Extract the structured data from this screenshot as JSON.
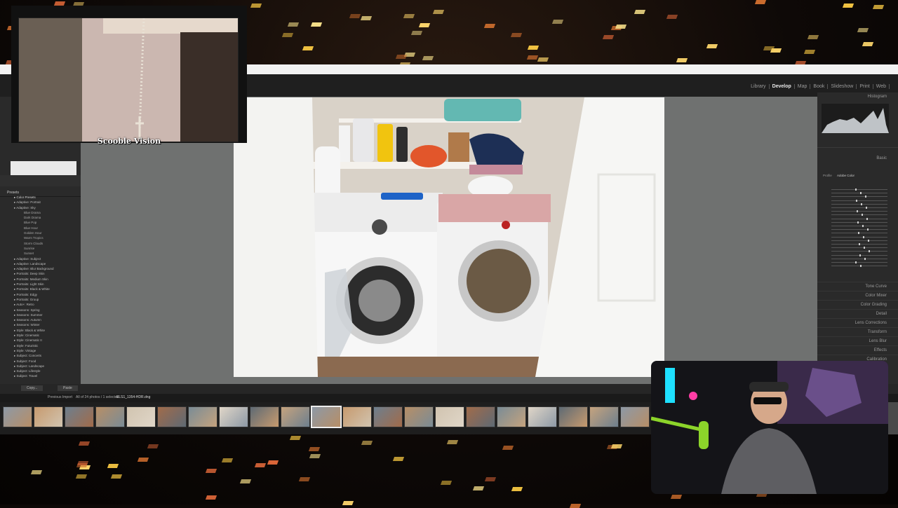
{
  "lightroom": {
    "modules": [
      "Library",
      "Develop",
      "Map",
      "Book",
      "Slideshow",
      "Print",
      "Web"
    ],
    "active_module": "Develop",
    "left_panel": {
      "section_title": "Presets",
      "presets": [
        {
          "label": "Color Presets",
          "kind": "head"
        },
        {
          "label": "Adaptive: Portrait",
          "kind": "item"
        },
        {
          "label": "Adaptive: Sky",
          "kind": "item"
        },
        {
          "label": "Blue Drama",
          "kind": "sub"
        },
        {
          "label": "Dark Drama",
          "kind": "sub"
        },
        {
          "label": "Blue Pop",
          "kind": "sub"
        },
        {
          "label": "Blue Hour",
          "kind": "sub"
        },
        {
          "label": "Golden Hour",
          "kind": "sub"
        },
        {
          "label": "Warm Tropics",
          "kind": "sub"
        },
        {
          "label": "Storm Clouds",
          "kind": "sub"
        },
        {
          "label": "Sunrise",
          "kind": "sub"
        },
        {
          "label": "Sunset",
          "kind": "sub"
        },
        {
          "label": "Adaptive: Subject",
          "kind": "item"
        },
        {
          "label": "Adaptive: Landscape",
          "kind": "item"
        },
        {
          "label": "Adaptive: Blur Background",
          "kind": "item"
        },
        {
          "label": "Portraits: Deep Skin",
          "kind": "item"
        },
        {
          "label": "Portraits: Medium Skin",
          "kind": "item"
        },
        {
          "label": "Portraits: Light Skin",
          "kind": "item"
        },
        {
          "label": "Portraits: Black & White",
          "kind": "item"
        },
        {
          "label": "Portraits: Edgy",
          "kind": "item"
        },
        {
          "label": "Portraits: Group",
          "kind": "item"
        },
        {
          "label": "Auto+: Retro",
          "kind": "item"
        },
        {
          "label": "Seasons: Spring",
          "kind": "item"
        },
        {
          "label": "Seasons: Summer",
          "kind": "item"
        },
        {
          "label": "Seasons: Autumn",
          "kind": "item"
        },
        {
          "label": "Seasons: Winter",
          "kind": "item"
        },
        {
          "label": "Style: Black & White",
          "kind": "item"
        },
        {
          "label": "Style: Cinematic",
          "kind": "item"
        },
        {
          "label": "Style: Cinematic II",
          "kind": "item"
        },
        {
          "label": "Style: Futuristic",
          "kind": "item"
        },
        {
          "label": "Style: Vintage",
          "kind": "item"
        },
        {
          "label": "Subject: Concerts",
          "kind": "item"
        },
        {
          "label": "Subject: Food",
          "kind": "item"
        },
        {
          "label": "Subject: Landscape",
          "kind": "item"
        },
        {
          "label": "Subject: Lifestyle",
          "kind": "item"
        },
        {
          "label": "Subject: Travel",
          "kind": "item"
        }
      ],
      "copy_label": "Copy...",
      "paste_label": "Paste"
    },
    "right_panel": {
      "histogram_title": "Histogram",
      "basic_title": "Basic",
      "profile_label": "Profile",
      "profile_value": "Adobe Color",
      "sections": [
        "Tone Curve",
        "Color Mixer",
        "Color Grading",
        "Detail",
        "Lens Corrections",
        "Transform",
        "Lens Blur",
        "Effects",
        "Calibration"
      ]
    },
    "filmstrip": {
      "source": "Previous Import",
      "count_text": "All of 24 photos / 1 selected",
      "filename": "ELS1_1354-HDR.dng",
      "thumbs": 22,
      "selected_index": 10
    }
  },
  "overlay": {
    "brand_text": "Scooble Vision"
  }
}
